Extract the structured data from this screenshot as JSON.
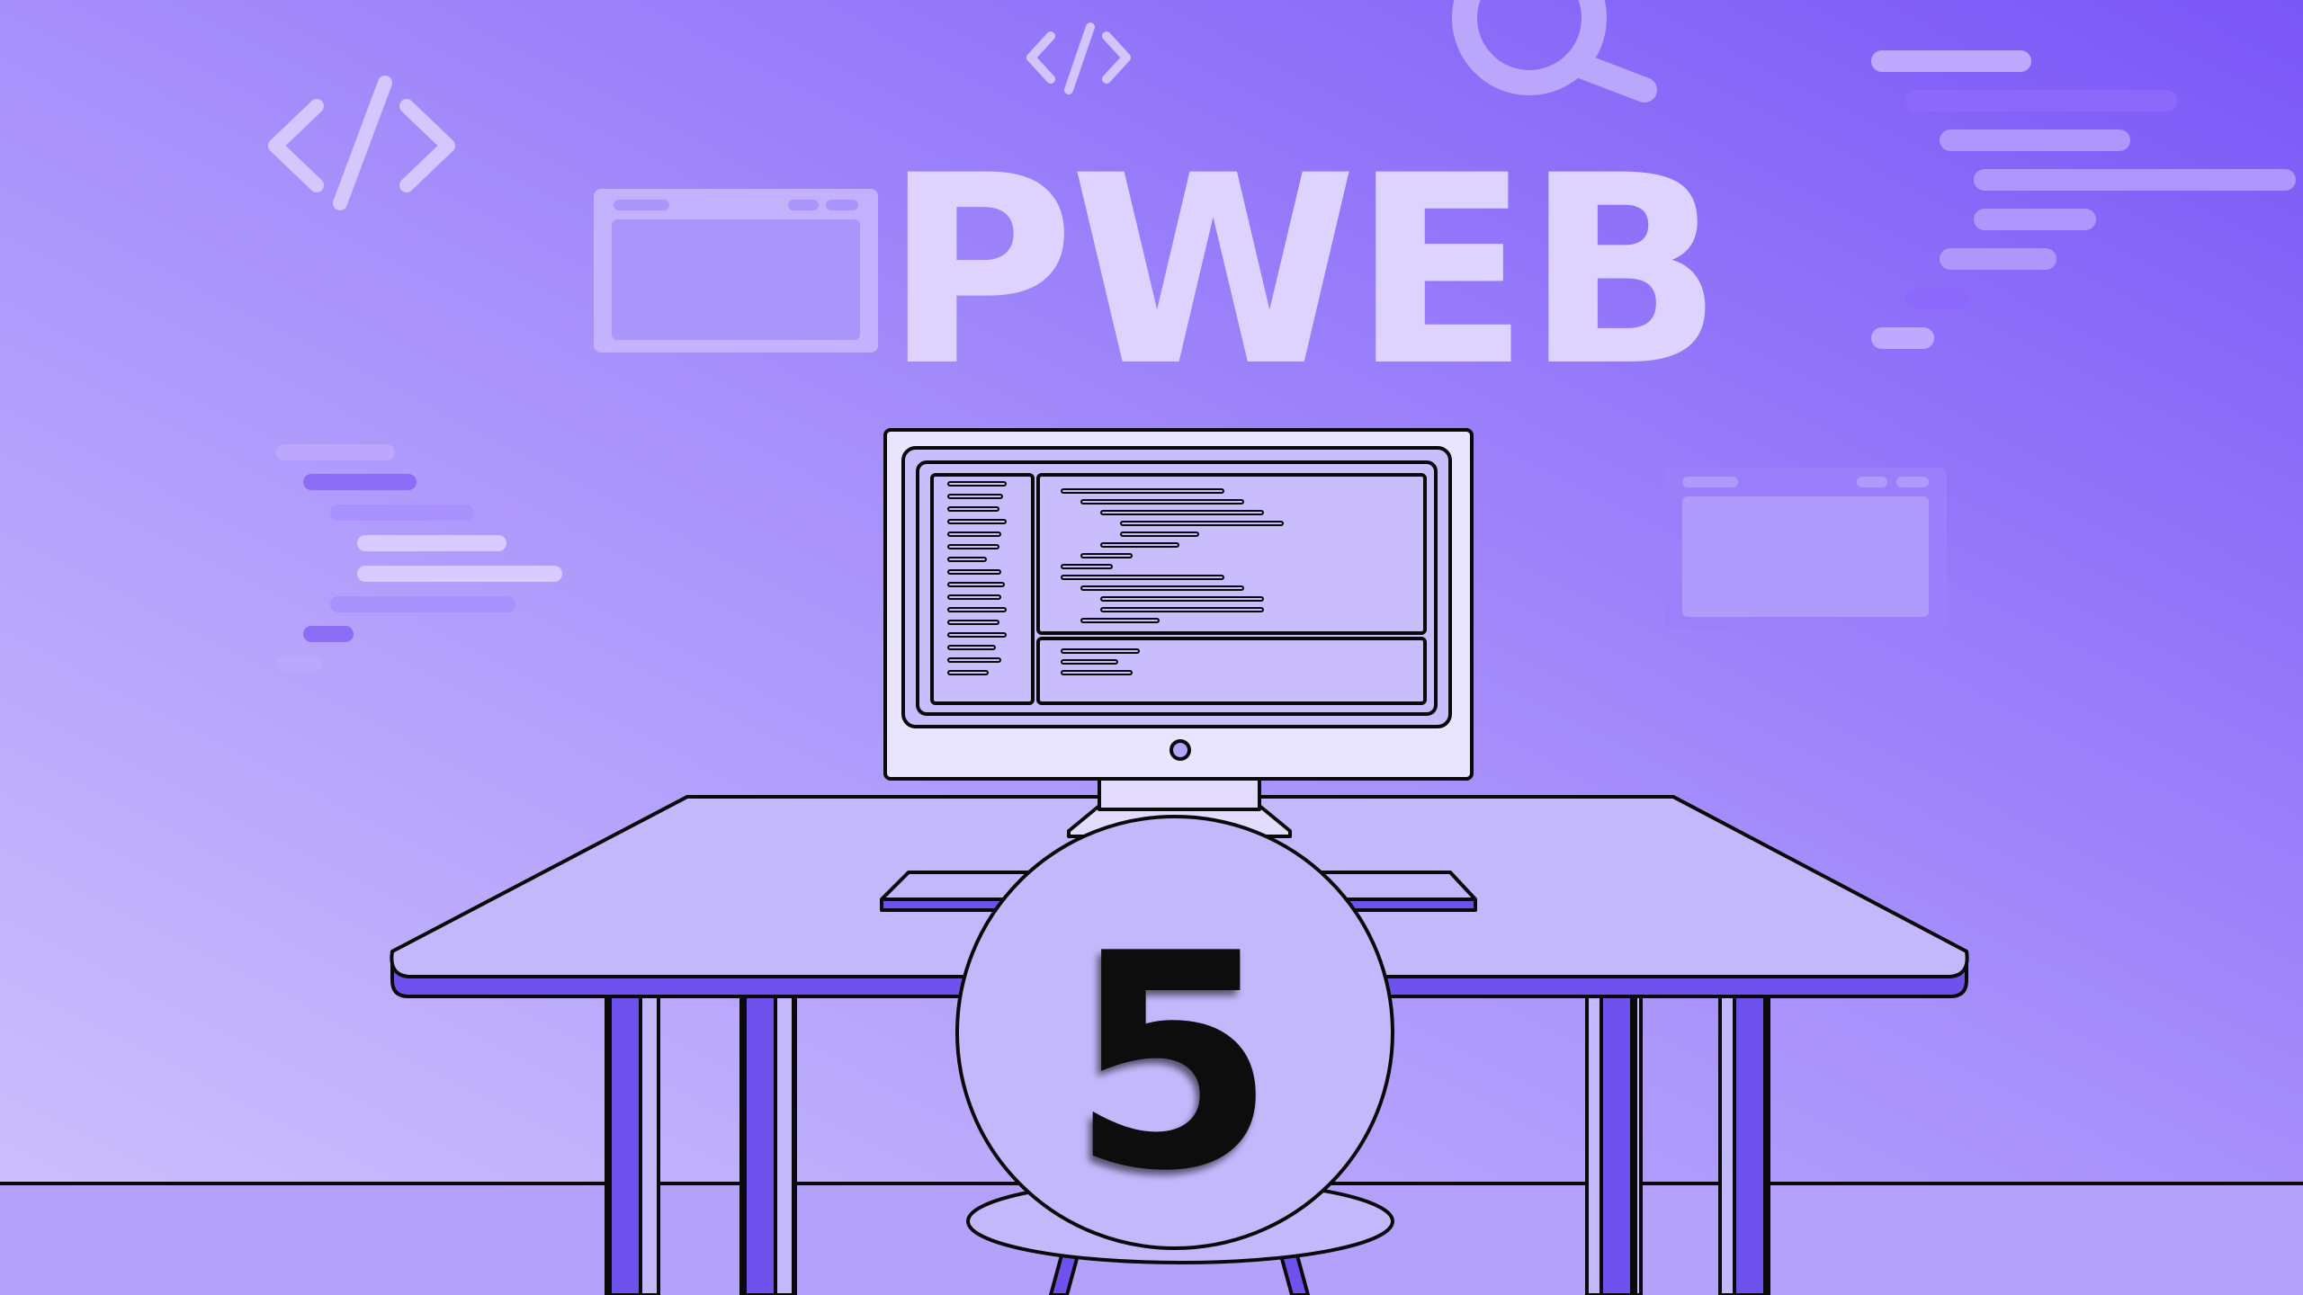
{
  "title": "PWEB",
  "number": "5",
  "colors": {
    "bg_light": "#c7bbfd",
    "bg_dark": "#7e5cf8",
    "ink": "#0a0a0a",
    "furniture_fill": "#c4b8fc",
    "accent_purple": "#6f52ee",
    "deco_light": "#dcd2ff"
  },
  "icons": {
    "code_large": "code-tag-icon",
    "code_small": "code-tag-icon",
    "search": "magnifier-icon",
    "window_left": "browser-window-icon",
    "window_right": "browser-window-icon"
  }
}
